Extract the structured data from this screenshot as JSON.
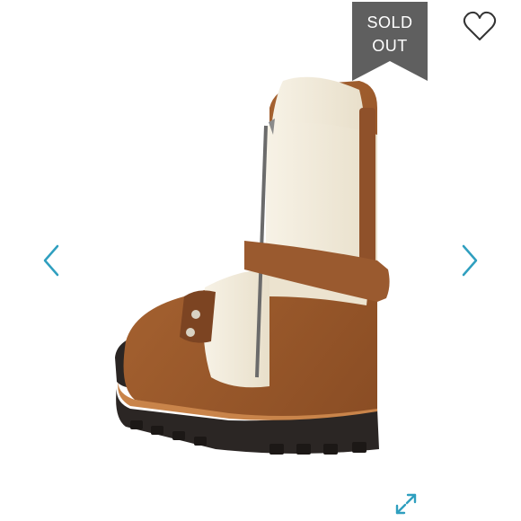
{
  "badge": {
    "line1": "SOLD",
    "line2": "OUT"
  },
  "icons": {
    "like": "heart-icon",
    "previous": "chevron-left-icon",
    "next": "chevron-right-icon",
    "expand": "expand-icon"
  },
  "colors": {
    "badge": "#5f5f5f",
    "accent": "#2f9fbf",
    "suede": "#9c5b2e",
    "shearling": "#f3ecdc"
  }
}
